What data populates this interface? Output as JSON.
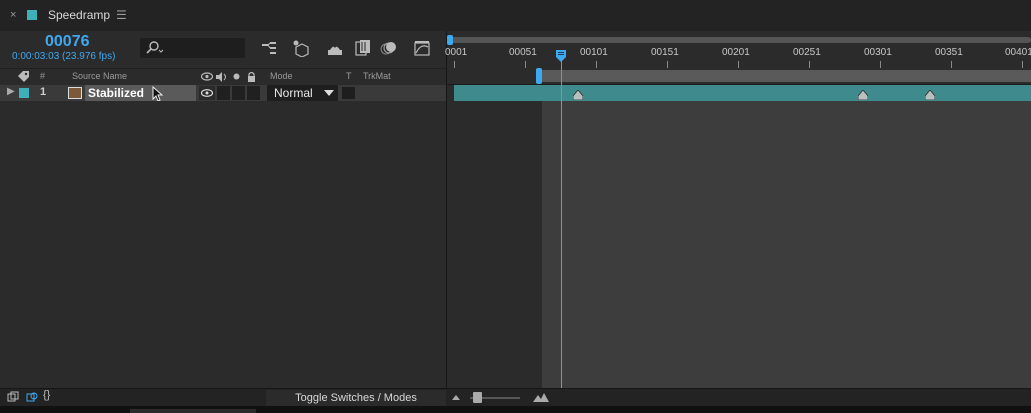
{
  "panel": {
    "close_glyph": "×",
    "title": "Speedramp",
    "menu_glyph": "☰",
    "label_color": "#3fb0b8"
  },
  "time": {
    "current_frame": "00076",
    "timecode": "0:00:03:03 (23.976 fps)",
    "accent_color": "#3fa9f0"
  },
  "search": {
    "placeholder": "",
    "icon": "search-icon"
  },
  "header_icons": [
    "comp-flowchart-icon",
    "draft-3d-icon",
    "shy-layers-icon",
    "frame-blending-icon",
    "motion-blur-icon",
    "graph-editor-icon"
  ],
  "columns": {
    "label_icon": "label-tag-icon",
    "number": "#",
    "source_name": "Source Name",
    "mode": "Mode",
    "track_matte_t": "T",
    "trkmat": "TrkMat"
  },
  "layers": [
    {
      "twirl": "▶",
      "number": "1",
      "name": "Stabilized",
      "mode": "Normal",
      "label_color": "#3fb0b8",
      "visible": true
    }
  ],
  "ruler": {
    "ticks": [
      "0001",
      "00051",
      "00101",
      "00151",
      "00201",
      "00251",
      "00301",
      "00351",
      "00401"
    ]
  },
  "bottom": {
    "toggle_label": "Toggle Switches / Modes",
    "braces_glyph": "{}"
  }
}
